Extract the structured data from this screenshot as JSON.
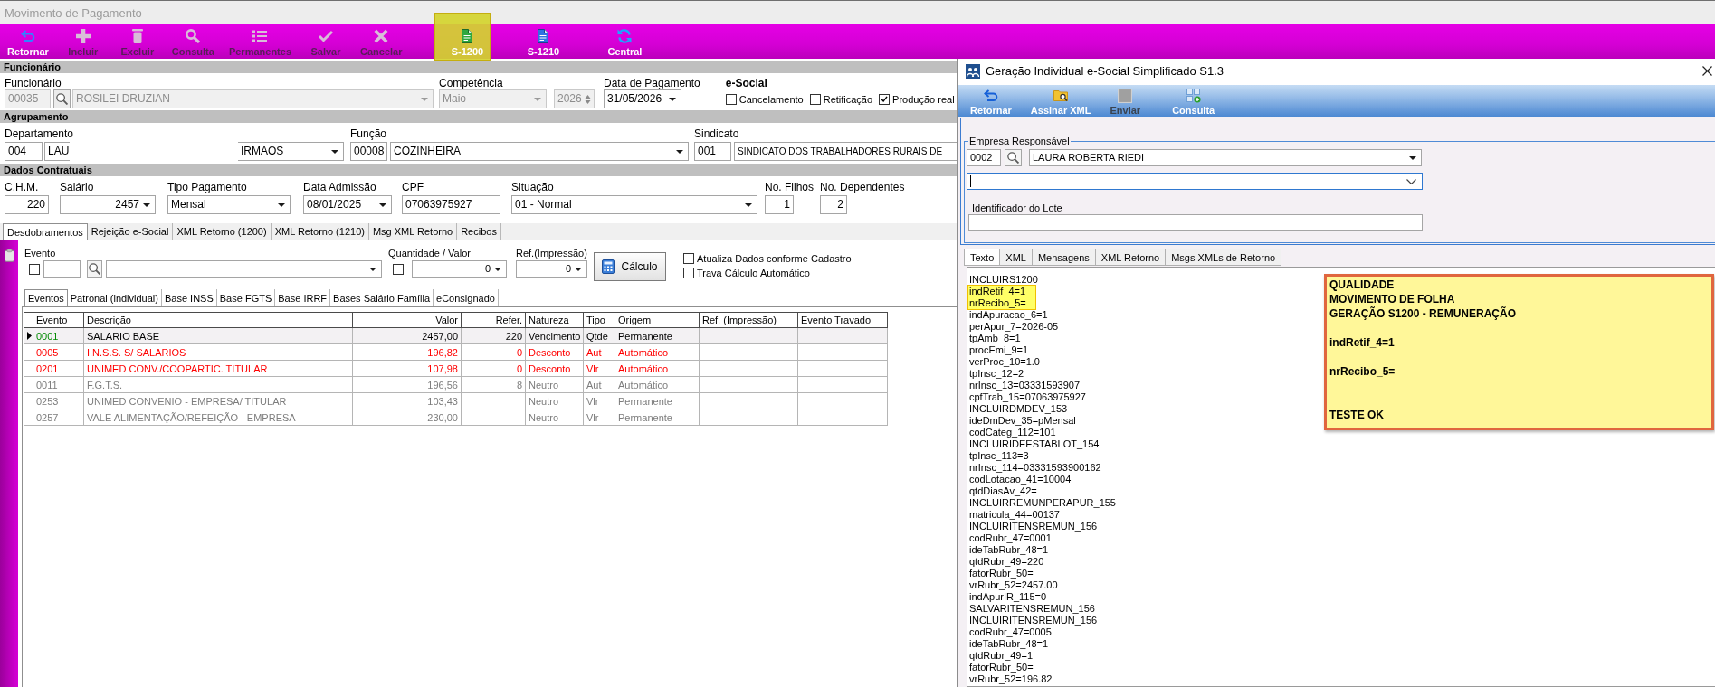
{
  "window": {
    "title": "Movimento de Pagamento"
  },
  "toolbar": [
    {
      "label": "Retornar",
      "disabled": false,
      "highlighted": false
    },
    {
      "label": "Incluir",
      "disabled": true,
      "highlighted": false
    },
    {
      "label": "Excluir",
      "disabled": true,
      "highlighted": false
    },
    {
      "label": "Consulta",
      "disabled": true,
      "highlighted": false
    },
    {
      "label": "Permanentes",
      "disabled": true,
      "highlighted": false
    },
    {
      "label": "Salvar",
      "disabled": true,
      "highlighted": false
    },
    {
      "label": "Cancelar",
      "disabled": true,
      "highlighted": false
    },
    {
      "label": "S-1200",
      "disabled": false,
      "highlighted": true
    },
    {
      "label": "S-1210",
      "disabled": false,
      "highlighted": false
    },
    {
      "label": "Central",
      "disabled": false,
      "highlighted": false
    }
  ],
  "employee_section": {
    "title": "Funcionário",
    "employee": {
      "label": "Funcionário",
      "code": "00035",
      "name": "ROSILEI DRUZIAN",
      "disabled": true
    },
    "period": {
      "label": "Competência",
      "month": "Maio",
      "year": "2026",
      "disabled": true
    },
    "payment_date": {
      "label": "Data de Pagamento",
      "value": "31/05/2026"
    },
    "esocial": {
      "label": "e-Social",
      "options": [
        {
          "label": "Cancelamento",
          "checked": false
        },
        {
          "label": "Retificação",
          "checked": false
        },
        {
          "label": "Produção real",
          "checked": true
        }
      ]
    }
  },
  "grouping_section": {
    "title": "Agrupamento",
    "department": {
      "label": "Departamento",
      "code": "004",
      "value_left": "LAU",
      "value_right": "IRMAOS"
    },
    "role": {
      "label": "Função",
      "code": "00008",
      "name": "COZINHEIRA"
    },
    "union": {
      "label": "Sindicato",
      "code": "001",
      "name": "SINDICATO DOS TRABALHADORES RURAIS DE"
    }
  },
  "contract_section": {
    "title": "Dados Contratuais",
    "fields": [
      {
        "label": "C.H.M.",
        "value": "220",
        "kind": "number"
      },
      {
        "label": "Salário",
        "value": "2457",
        "kind": "numselect"
      },
      {
        "label": "Tipo Pagamento",
        "value": "Mensal",
        "kind": "select"
      },
      {
        "label": "Data Admissão",
        "value": "08/01/2025",
        "kind": "select"
      },
      {
        "label": "CPF",
        "value": "07063975927",
        "kind": "text"
      },
      {
        "label": "Situação",
        "value": "01 - Normal",
        "kind": "select"
      },
      {
        "label": "No. Filhos",
        "value": "1",
        "kind": "number"
      },
      {
        "label": "No. Dependentes",
        "value": "2",
        "kind": "number"
      }
    ]
  },
  "tabs": [
    {
      "label": "Desdobramentos",
      "selected": true
    },
    {
      "label": "Rejeição e-Social",
      "selected": false
    },
    {
      "label": "XML Retorno (1200)",
      "selected": false
    },
    {
      "label": "XML Retorno (1210)",
      "selected": false
    },
    {
      "label": "Msg XML Retorno",
      "selected": false
    },
    {
      "label": "Recibos",
      "selected": false
    }
  ],
  "event_form": {
    "event": {
      "label": "Evento",
      "checked": false
    },
    "quantity": {
      "label": "Quantidade / Valor",
      "checked": false,
      "value": "0"
    },
    "print_ref": {
      "label": "Ref.(Impressão)",
      "value": "0"
    },
    "calculate_button": "Cálculo",
    "options": [
      {
        "label": "Atualiza Dados conforme Cadastro",
        "checked": false
      },
      {
        "label": "Trava Cálculo Automático",
        "checked": false
      }
    ]
  },
  "subtabs": [
    {
      "label": "Eventos",
      "selected": true
    },
    {
      "label": "Patronal (individual)",
      "selected": false
    },
    {
      "label": "Base INSS",
      "selected": false
    },
    {
      "label": "Base FGTS",
      "selected": false
    },
    {
      "label": "Base IRRF",
      "selected": false
    },
    {
      "label": "Bases Salário Família",
      "selected": false
    },
    {
      "label": "eConsignado",
      "selected": false
    }
  ],
  "table": {
    "columns": [
      "Evento",
      "Descrição",
      "Valor",
      "Refer.",
      "Natureza",
      "Tipo",
      "Origem",
      "Ref. (Impressão)",
      "Evento Travado"
    ],
    "rows": [
      {
        "kind": "earning",
        "selected": true,
        "event": "0001",
        "description": "SALARIO BASE",
        "value": "2457,00",
        "reference": "220",
        "nature": "Vencimento",
        "type": "Qtde",
        "origin": "Permanente"
      },
      {
        "kind": "deduction",
        "selected": false,
        "event": "0005",
        "description": "I.N.S.S. S/ SALARIOS",
        "value": "196,82",
        "reference": "0",
        "nature": "Desconto",
        "type": "Aut",
        "origin": "Automático"
      },
      {
        "kind": "deduction",
        "selected": false,
        "event": "0201",
        "description": "UNIMED CONV./COOPARTIC. TITULAR",
        "value": "107,98",
        "reference": "0",
        "nature": "Desconto",
        "type": "Vlr",
        "origin": "Automático"
      },
      {
        "kind": "neutral",
        "selected": false,
        "event": "0011",
        "description": "F.G.T.S.",
        "value": "196,56",
        "reference": "8",
        "nature": "Neutro",
        "type": "Aut",
        "origin": "Automático"
      },
      {
        "kind": "neutral",
        "selected": false,
        "event": "0253",
        "description": "UNIMED CONVENIO - EMPRESA/ TITULAR",
        "value": "103,43",
        "nature": "Neutro",
        "type": "Vlr",
        "origin": "Permanente"
      },
      {
        "kind": "neutral",
        "selected": false,
        "event": "0257",
        "description": "VALE ALIMENTAÇÃO/REFEIÇÃO - EMPRESA",
        "value": "230,00",
        "nature": "Neutro",
        "type": "Vlr",
        "origin": "Permanente"
      }
    ]
  },
  "dialog": {
    "title": "Geração Individual e-Social Simplificado S1.3",
    "toolbar": [
      {
        "label": "Retornar",
        "disabled": false
      },
      {
        "label": "Assinar XML",
        "disabled": false
      },
      {
        "label": "Enviar",
        "disabled": true
      },
      {
        "label": "Consulta",
        "disabled": false
      }
    ],
    "company": {
      "label": "Empresa Responsável",
      "code": "0002",
      "name": "LAURA ROBERTA RIEDI"
    },
    "selector": {
      "focused": true
    },
    "batch": {
      "label": "Identificador do Lote"
    },
    "tabs": [
      {
        "label": "Texto",
        "selected": true
      },
      {
        "label": "XML",
        "selected": false
      },
      {
        "label": "Mensagens",
        "selected": false
      },
      {
        "label": "XML Retorno",
        "selected": false
      },
      {
        "label": "Msgs XMLs de Retorno",
        "selected": false
      }
    ],
    "text_lines": [
      {
        "text": "INCLUIRS1200",
        "highlighted": false
      },
      {
        "text": "indRetif_4=1",
        "highlighted": true
      },
      {
        "text": "nrRecibo_5=",
        "highlighted": true
      },
      {
        "text": "indApuracao_6=1",
        "highlighted": false
      },
      {
        "text": "perApur_7=2026-05",
        "highlighted": false
      },
      {
        "text": "tpAmb_8=1",
        "highlighted": false
      },
      {
        "text": "procEmi_9=1",
        "highlighted": false
      },
      {
        "text": "verProc_10=1.0",
        "highlighted": false
      },
      {
        "text": "tpInsc_12=2",
        "highlighted": false
      },
      {
        "text": "nrInsc_13=03331593907",
        "highlighted": false
      },
      {
        "text": "cpfTrab_15=07063975927",
        "highlighted": false
      },
      {
        "text": "INCLUIRDMDEV_153",
        "highlighted": false
      },
      {
        "text": "ideDmDev_35=pMensal",
        "highlighted": false
      },
      {
        "text": "codCateg_112=101",
        "highlighted": false
      },
      {
        "text": "INCLUIRIDEESTABLOT_154",
        "highlighted": false
      },
      {
        "text": "tpInsc_113=3",
        "highlighted": false
      },
      {
        "text": "nrInsc_114=03331593900162",
        "highlighted": false
      },
      {
        "text": "codLotacao_41=10004",
        "highlighted": false
      },
      {
        "text": "qtdDiasAv_42=",
        "highlighted": false
      },
      {
        "text": "INCLUIRREMUNPERAPUR_155",
        "highlighted": false
      },
      {
        "text": "matricula_44=00137",
        "highlighted": false
      },
      {
        "text": "INCLUIRITENSREMUN_156",
        "highlighted": false
      },
      {
        "text": "codRubr_47=0001",
        "highlighted": false
      },
      {
        "text": "ideTabRubr_48=1",
        "highlighted": false
      },
      {
        "text": "qtdRubr_49=220",
        "highlighted": false
      },
      {
        "text": "fatorRubr_50=",
        "highlighted": false
      },
      {
        "text": "vrRubr_52=2457.00",
        "highlighted": false
      },
      {
        "text": "indApurIR_115=0",
        "highlighted": false
      },
      {
        "text": "SALVARITENSREMUN_156",
        "highlighted": false
      },
      {
        "text": "INCLUIRITENSREMUN_156",
        "highlighted": false
      },
      {
        "text": "codRubr_47=0005",
        "highlighted": false
      },
      {
        "text": "ideTabRubr_48=1",
        "highlighted": false
      },
      {
        "text": "qtdRubr_49=1",
        "highlighted": false
      },
      {
        "text": "fatorRubr_50=",
        "highlighted": false
      },
      {
        "text": "vrRubr_52=196.82",
        "highlighted": false
      }
    ],
    "note": {
      "blocks": [
        [
          "QUALIDADE",
          "MOVIMENTO DE FOLHA",
          "GERAÇÃO S1200 - REMUNERAÇÃO"
        ],
        [
          "indRetif_4=1"
        ],
        [
          "nrRecibo_5="
        ],
        [
          "TESTE OK"
        ]
      ]
    }
  }
}
